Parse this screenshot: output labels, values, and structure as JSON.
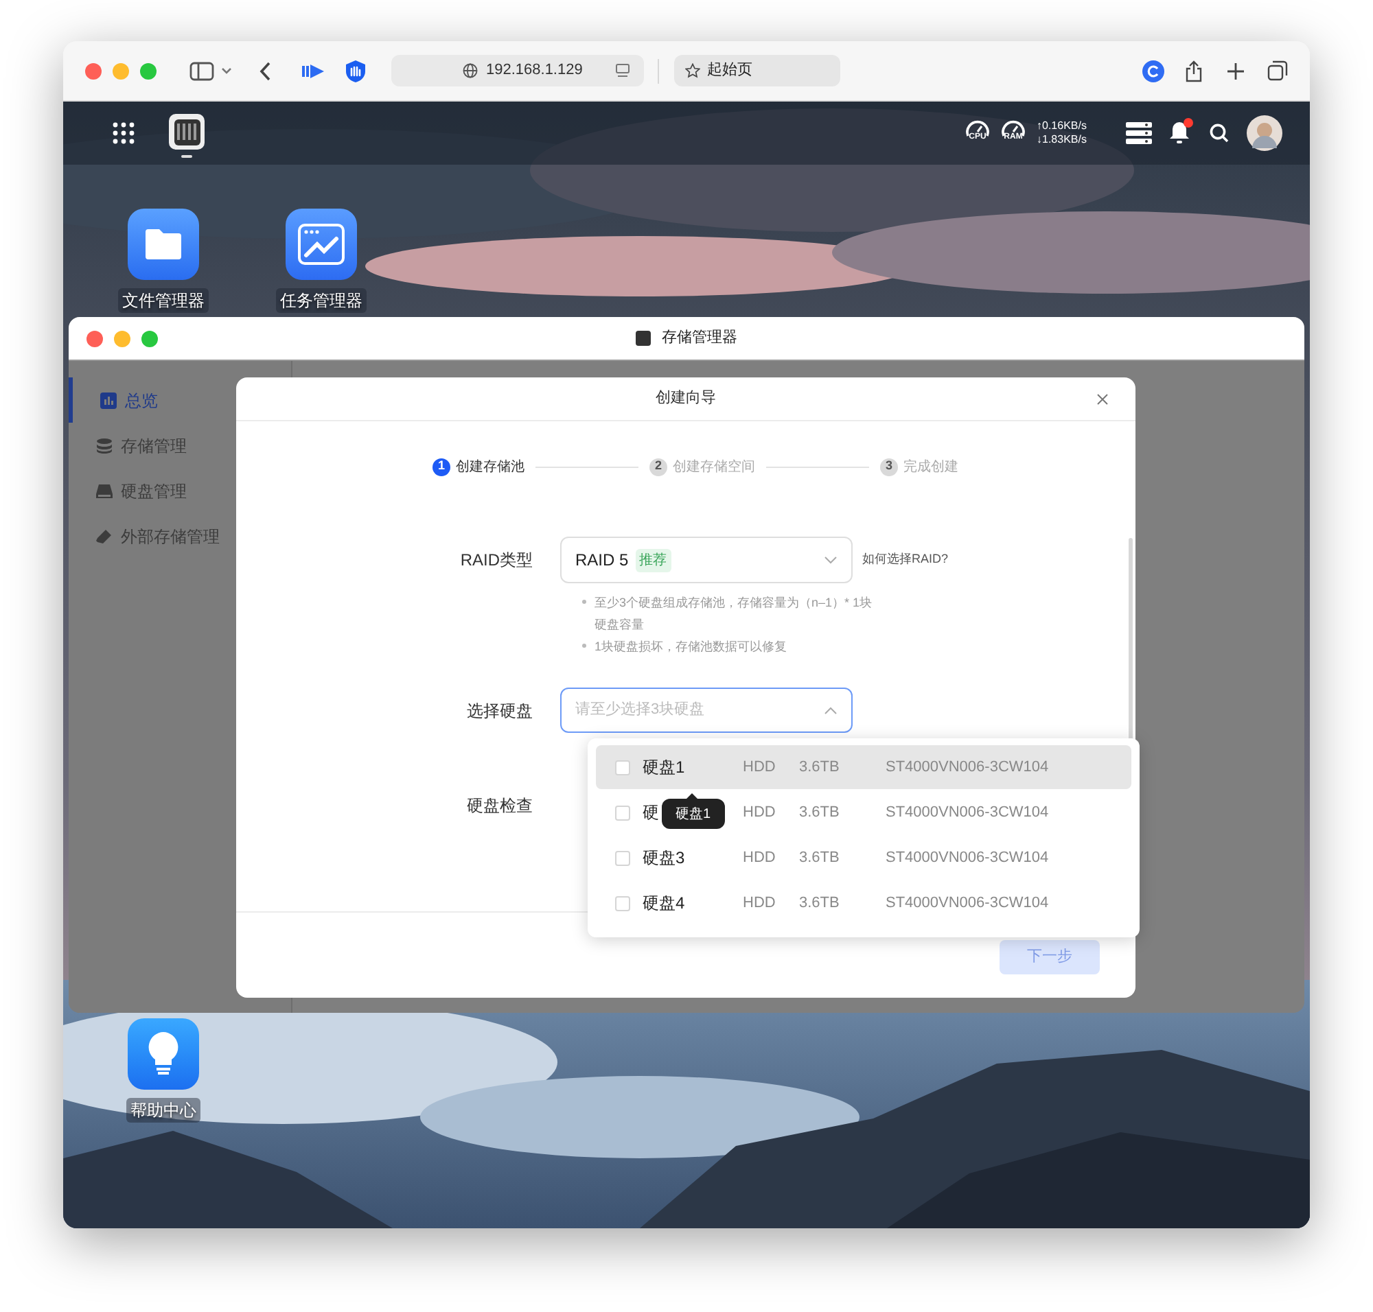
{
  "browser": {
    "address": "192.168.1.129",
    "tab_title": "起始页"
  },
  "top_bar": {
    "meters": [
      {
        "label": "CPU"
      },
      {
        "label": "RAM"
      }
    ],
    "upload": "↑0.16KB/s",
    "download": "↓1.83KB/s",
    "notification_unread": true
  },
  "desktop_icons": [
    {
      "kind": "folder",
      "label": "文件管理器"
    },
    {
      "kind": "chart",
      "label": "任务管理器"
    },
    {
      "kind": "bulb",
      "label": "帮助中心"
    }
  ],
  "window": {
    "title": "存储管理器"
  },
  "sidebar": {
    "items": [
      {
        "kind": "overview",
        "label": "总览",
        "selected": true
      },
      {
        "kind": "storage",
        "label": "存储管理",
        "selected": false
      },
      {
        "kind": "disk",
        "label": "硬盘管理",
        "selected": false
      },
      {
        "kind": "external",
        "label": "外部存储管理",
        "selected": false
      }
    ]
  },
  "dialog": {
    "title": "创建向导",
    "steps": [
      {
        "number": "1",
        "label": "创建存储池",
        "selected": true
      },
      {
        "number": "2",
        "label": "创建存储空间",
        "selected": false
      },
      {
        "number": "3",
        "label": "完成创建",
        "selected": false
      }
    ],
    "raid_type": {
      "label": "RAID类型",
      "value": "RAID 5",
      "badge": "推荐",
      "help_link": "如何选择RAID?",
      "notes": [
        "至少3个硬盘组成存储池，存储容量为（n–1）* 1块硬盘容量",
        "1块硬盘损坏，存储池数据可以修复"
      ]
    },
    "disk_select": {
      "label": "选择硬盘",
      "placeholder": "请至少选择3块硬盘",
      "expanded": true
    },
    "disk_check": {
      "label": "硬盘检查"
    },
    "disk_options": [
      {
        "name": "硬盘1",
        "type": "HDD",
        "size": "3.6TB",
        "model": "ST4000VN006-3CW104",
        "checked": false,
        "highlighted": true
      },
      {
        "name": "硬",
        "type": "HDD",
        "size": "3.6TB",
        "model": "ST4000VN006-3CW104",
        "checked": false,
        "highlighted": false
      },
      {
        "name": "硬盘3",
        "type": "HDD",
        "size": "3.6TB",
        "model": "ST4000VN006-3CW104",
        "checked": false,
        "highlighted": false
      },
      {
        "name": "硬盘4",
        "type": "HDD",
        "size": "3.6TB",
        "model": "ST4000VN006-3CW104",
        "checked": false,
        "highlighted": false
      }
    ],
    "tooltip": "硬盘1",
    "next_button": {
      "label": "下一步",
      "disabled": true
    }
  }
}
